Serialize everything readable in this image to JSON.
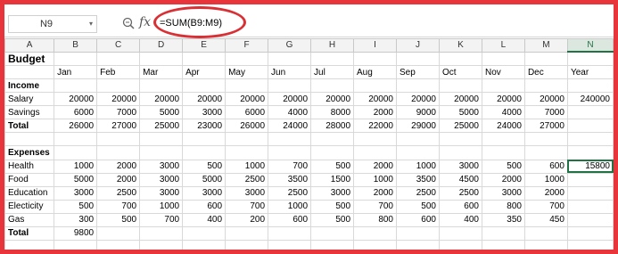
{
  "namebox": {
    "cell_ref": "N9"
  },
  "formula": {
    "text": "=SUM(B9:M9)"
  },
  "columns": [
    "A",
    "B",
    "C",
    "D",
    "E",
    "F",
    "G",
    "H",
    "I",
    "J",
    "K",
    "L",
    "M",
    "N"
  ],
  "selected_column": "N",
  "sheet": {
    "title": "Budget",
    "months": [
      "Jan",
      "Feb",
      "Mar",
      "Apr",
      "May",
      "Jun",
      "Jul",
      "Aug",
      "Sep",
      "Oct",
      "Nov",
      "Dec",
      "Year"
    ],
    "income_label": "Income",
    "income_rows": [
      {
        "label": "Salary",
        "values": [
          "20000",
          "20000",
          "20000",
          "20000",
          "20000",
          "20000",
          "20000",
          "20000",
          "20000",
          "20000",
          "20000",
          "20000",
          "240000"
        ]
      },
      {
        "label": "Savings",
        "values": [
          "6000",
          "7000",
          "5000",
          "3000",
          "6000",
          "4000",
          "8000",
          "2000",
          "9000",
          "5000",
          "4000",
          "7000",
          ""
        ]
      },
      {
        "label": "Total",
        "values": [
          "26000",
          "27000",
          "25000",
          "23000",
          "26000",
          "24000",
          "28000",
          "22000",
          "29000",
          "25000",
          "24000",
          "27000",
          ""
        ]
      }
    ],
    "expenses_label": "Expenses",
    "expense_rows": [
      {
        "label": "Health",
        "values": [
          "1000",
          "2000",
          "3000",
          "500",
          "1000",
          "700",
          "500",
          "2000",
          "1000",
          "3000",
          "500",
          "600",
          "15800"
        ]
      },
      {
        "label": "Food",
        "values": [
          "5000",
          "2000",
          "3000",
          "5000",
          "2500",
          "3500",
          "1500",
          "1000",
          "3500",
          "4500",
          "2000",
          "1000",
          ""
        ]
      },
      {
        "label": "Education",
        "values": [
          "3000",
          "2500",
          "3000",
          "3000",
          "3000",
          "2500",
          "3000",
          "2000",
          "2500",
          "2500",
          "3000",
          "2000",
          ""
        ]
      },
      {
        "label": "Electicity",
        "values": [
          "500",
          "700",
          "1000",
          "600",
          "700",
          "1000",
          "500",
          "700",
          "500",
          "600",
          "800",
          "700",
          ""
        ]
      },
      {
        "label": "Gas",
        "values": [
          "300",
          "500",
          "700",
          "400",
          "200",
          "600",
          "500",
          "800",
          "600",
          "400",
          "350",
          "450",
          ""
        ]
      },
      {
        "label": "Total",
        "values": [
          "9800",
          "",
          "",
          "",
          "",
          "",
          "",
          "",
          "",
          "",
          "",
          "",
          ""
        ]
      }
    ]
  }
}
